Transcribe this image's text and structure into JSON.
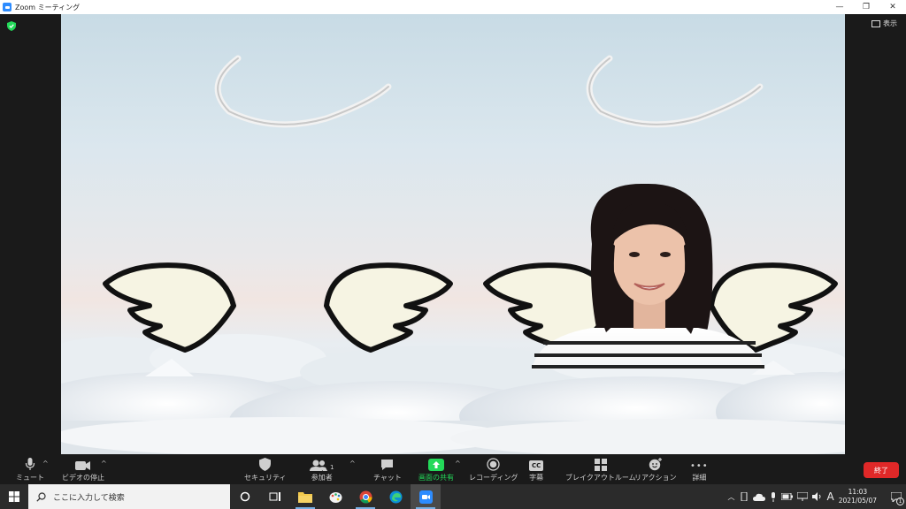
{
  "window": {
    "title": "Zoom ミーティング",
    "minimize": "—",
    "restore": "❐",
    "close": "✕"
  },
  "meeting": {
    "view_label": "表示"
  },
  "toolbar": {
    "mute": "ミュート",
    "video_stop": "ビデオの停止",
    "security": "セキュリティ",
    "participants": "参加者",
    "participants_count": "1",
    "chat": "チャット",
    "share_screen": "画面の共有",
    "recording": "レコーディング",
    "captions": "字幕",
    "breakout": "ブレイクアウトルーム",
    "reactions": "リアクション",
    "more": "詳細",
    "end": "終了",
    "cc_badge": "CC",
    "more_dots": "•••"
  },
  "taskbar": {
    "search_placeholder": "ここに入力して検索",
    "time": "11:03",
    "date": "2021/05/07",
    "ime": "A",
    "notification_count": "1"
  },
  "colors": {
    "share_green": "#23d959",
    "end_red": "#e02828",
    "zoom_blue": "#2d8cff"
  }
}
